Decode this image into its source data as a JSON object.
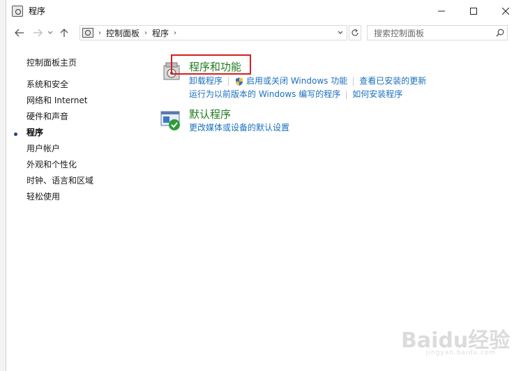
{
  "window": {
    "title": "程序"
  },
  "address": {
    "crumbs": [
      "控制面板",
      "程序"
    ]
  },
  "search": {
    "placeholder": "搜索控制面板"
  },
  "sidebar": {
    "home": "控制面板主页",
    "items": [
      {
        "label": "系统和安全"
      },
      {
        "label": "网络和 Internet"
      },
      {
        "label": "硬件和声音"
      },
      {
        "label": "程序",
        "active": true
      },
      {
        "label": "用户帐户"
      },
      {
        "label": "外观和个性化"
      },
      {
        "label": "时钟、语言和区域"
      },
      {
        "label": "轻松使用"
      }
    ]
  },
  "categories": [
    {
      "title": "程序和功能",
      "links": [
        "卸载程序",
        "启用或关闭 Windows 功能",
        "查看已安装的更新",
        "运行为以前版本的 Windows 编写的程序",
        "如何安装程序"
      ]
    },
    {
      "title": "默认程序",
      "links": [
        "更改媒体或设备的默认设置"
      ]
    }
  ],
  "colors": {
    "link": "#1a6fbf",
    "category_title": "#1e7b1e",
    "highlight": "#d81e1e"
  },
  "watermark": {
    "text": "Baidu经验",
    "sub": "jingyan.baidu.com"
  }
}
